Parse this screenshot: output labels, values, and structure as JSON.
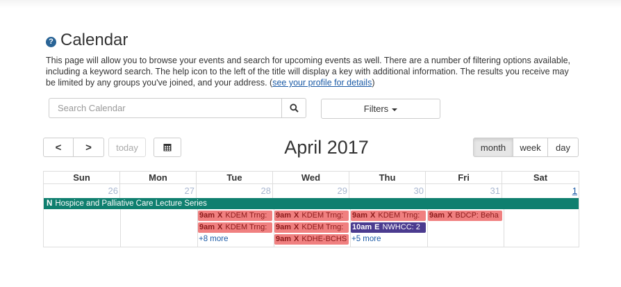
{
  "page": {
    "help_icon": "?",
    "title": "Calendar",
    "description": "This page will allow you to browse your events and search for upcoming events as well. There are a number of filtering options available, including a keyword search. The help icon to the left of the title will display a key with additional information. The results you receive may be limited by any groups you've joined, and your address. (",
    "profile_link": "see your profile for details",
    "description_end": ")"
  },
  "search": {
    "placeholder": "Search Calendar"
  },
  "filters": {
    "label": "Filters"
  },
  "toolbar": {
    "prev": "<",
    "next": ">",
    "today": "today",
    "title": "April 2017",
    "views": {
      "month": "month",
      "week": "week",
      "day": "day"
    },
    "active_view": "month"
  },
  "calendar": {
    "weekdays": [
      "Sun",
      "Mon",
      "Tue",
      "Wed",
      "Thu",
      "Fri",
      "Sat"
    ],
    "day_numbers": [
      "26",
      "27",
      "28",
      "29",
      "30",
      "31",
      "1"
    ],
    "banner": {
      "badge": "N",
      "title": "Hospice and Palliative Care Lecture Series",
      "color": "#0f7f6f"
    },
    "events": [
      {
        "time": "9am",
        "badge": "X",
        "title": "KDEM Trng:",
        "day": "Tue",
        "color": "#f08080"
      },
      {
        "time": "9am",
        "badge": "X",
        "title": "KDEM Trng:",
        "day": "Tue",
        "color": "#f08080"
      },
      {
        "time": "9am",
        "badge": "X",
        "title": "KDEM Trng:",
        "day": "Wed",
        "color": "#f08080"
      },
      {
        "time": "9am",
        "badge": "X",
        "title": "KDEM Trng:",
        "day": "Wed",
        "color": "#f08080"
      },
      {
        "time": "9am",
        "badge": "X",
        "title": "KDHE-BCHS",
        "day": "Wed",
        "color": "#f08080"
      },
      {
        "time": "9am",
        "badge": "X",
        "title": "KDEM Trng:",
        "day": "Thu",
        "color": "#f08080"
      },
      {
        "time": "10am",
        "badge": "E",
        "title": "NWHCC: 2",
        "day": "Thu",
        "color": "#4b3b8f"
      },
      {
        "time": "9am",
        "badge": "X",
        "title": "BDCP: Beha",
        "day": "Fri",
        "color": "#f08080"
      }
    ],
    "more": {
      "tue": "+8 more",
      "thu": "+5 more"
    }
  }
}
